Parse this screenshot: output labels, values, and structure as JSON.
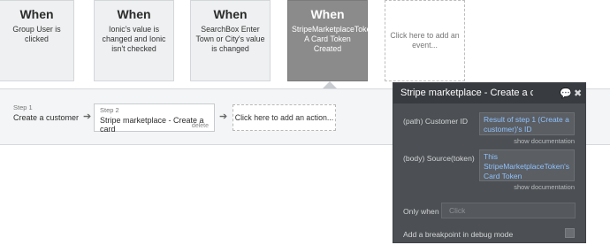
{
  "events": [
    {
      "when": "When",
      "description": "Group User is clicked"
    },
    {
      "when": "When",
      "description": "Ionic's value is changed and Ionic isn't checked"
    },
    {
      "when": "When",
      "description": "SearchBox Enter Town or City's value is changed"
    },
    {
      "when": "When",
      "description": "StripeMarketplaceToke A Card Token Created"
    }
  ],
  "add_event": "Click here to add an event...",
  "actions": {
    "step1": {
      "num": "Step 1",
      "name": "Create a customer"
    },
    "step2": {
      "num": "Step 2",
      "name": "Stripe marketplace - Create a card",
      "delete": "delete"
    },
    "add_action": "Click here to add an action...",
    "arrow_glyph": "➔"
  },
  "panel": {
    "title": "Stripe marketplace - Create a card",
    "comment_icon": "💬",
    "close_icon": "✖",
    "fields": [
      {
        "label": "(path) Customer ID",
        "value": "Result of step 1 (Create a customer)'s ID",
        "doc": "show documentation"
      },
      {
        "label": "(body) Source(token)",
        "value": "This StripeMarketplaceToken's Card Token",
        "doc": "show documentation"
      }
    ],
    "only_when_label": "Only when",
    "only_when_placeholder": "Click",
    "breakpoint_label": "Add a breakpoint in debug mode"
  }
}
